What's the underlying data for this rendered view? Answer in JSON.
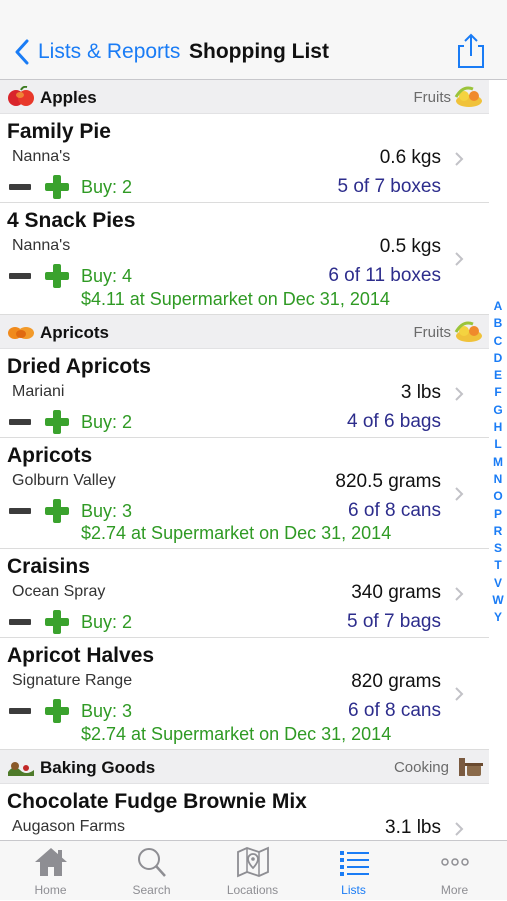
{
  "nav": {
    "back_label": "Lists & Reports",
    "title": "Shopping List"
  },
  "sections": [
    {
      "name": "Apples",
      "category": "Fruits",
      "items": [
        {
          "name": "Family Pie",
          "brand": "Nanna's",
          "qty": "0.6 kgs",
          "buy": "Buy: 2",
          "stock": "5 of 7 boxes",
          "price": ""
        },
        {
          "name": "4 Snack Pies",
          "brand": "Nanna's",
          "qty": "0.5 kgs",
          "buy": "Buy: 4",
          "stock": "6 of 11 boxes",
          "price": "$4.11 at Supermarket on Dec 31, 2014"
        }
      ]
    },
    {
      "name": "Apricots",
      "category": "Fruits",
      "items": [
        {
          "name": "Dried Apricots",
          "brand": "Mariani",
          "qty": "3 lbs",
          "buy": "Buy: 2",
          "stock": "4 of 6 bags",
          "price": ""
        },
        {
          "name": "Apricots",
          "brand": "Golburn Valley",
          "qty": "820.5 grams",
          "buy": "Buy: 3",
          "stock": "6 of 8 cans",
          "price": "$2.74 at Supermarket on Dec 31, 2014"
        },
        {
          "name": "Craisins",
          "brand": "Ocean Spray",
          "qty": "340 grams",
          "buy": "Buy: 2",
          "stock": "5 of 7 bags",
          "price": ""
        },
        {
          "name": "Apricot Halves",
          "brand": "Signature Range",
          "qty": "820 grams",
          "buy": "Buy: 3",
          "stock": "6 of 8 cans",
          "price": "$2.74 at Supermarket on Dec 31, 2014"
        }
      ]
    },
    {
      "name": "Baking Goods",
      "category": "Cooking",
      "items": [
        {
          "name": "Chocolate Fudge Brownie Mix",
          "brand": "Augason Farms",
          "qty": "3.1 lbs",
          "buy": "",
          "stock": "",
          "price": ""
        }
      ]
    }
  ],
  "index_letters": [
    "A",
    "B",
    "C",
    "D",
    "E",
    "F",
    "G",
    "H",
    "L",
    "M",
    "N",
    "O",
    "P",
    "R",
    "S",
    "T",
    "V",
    "W",
    "Y"
  ],
  "tabs": [
    {
      "label": "Home",
      "icon": "house-icon"
    },
    {
      "label": "Search",
      "icon": "magnifier-icon"
    },
    {
      "label": "Locations",
      "icon": "map-pin-icon"
    },
    {
      "label": "Lists",
      "icon": "list-icon"
    },
    {
      "label": "More",
      "icon": "ellipsis-icon"
    }
  ],
  "colors": {
    "accent": "#1a7cf5",
    "buy_green": "#2f9a24",
    "stock_navy": "#2d2d8c",
    "section_bg": "#efeff1"
  }
}
